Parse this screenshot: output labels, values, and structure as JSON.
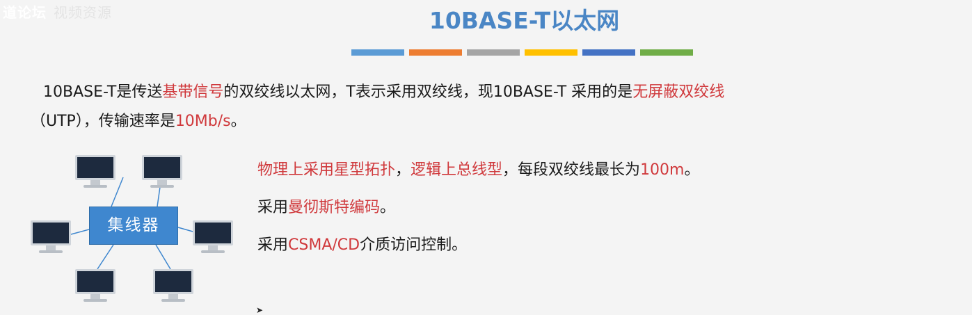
{
  "watermark": {
    "text1": "道论坛",
    "text2": "视频资源"
  },
  "title": "10BASE-T以太网",
  "title_bar_colors": [
    "#5b9bd5",
    "#ed7d31",
    "#a5a5a5",
    "#ffc000",
    "#4472c4",
    "#70ad47"
  ],
  "paragraph": {
    "p1": "10BASE-T是传送",
    "p2_red": "基带信号",
    "p3": "的双绞线以太网，T表示采用双绞线，现10BASE-T 采用的是",
    "p4_red": "无屏蔽双绞线",
    "p5": "（UTP），传输速率是",
    "p6_red": "10Mb/s",
    "p7": "。"
  },
  "diagram": {
    "hub_label": "集线器"
  },
  "features": {
    "f1_red1": "物理上采用星型拓扑",
    "f1_sep": "，",
    "f1_red2": "逻辑上总线型",
    "f1_text": "，每段双绞线最长为",
    "f1_red3": "100m",
    "f1_end": "。",
    "f2_text": "采用",
    "f2_red": "曼彻斯特编码",
    "f2_end": "。",
    "f3_text": "采用",
    "f3_red": "CSMA/CD",
    "f3_end": "介质访问控制。"
  },
  "colors": {
    "title": "#4a86c5",
    "highlight": "#d0393c",
    "hub": "#3f87cf",
    "background": "#f4f4f4"
  }
}
